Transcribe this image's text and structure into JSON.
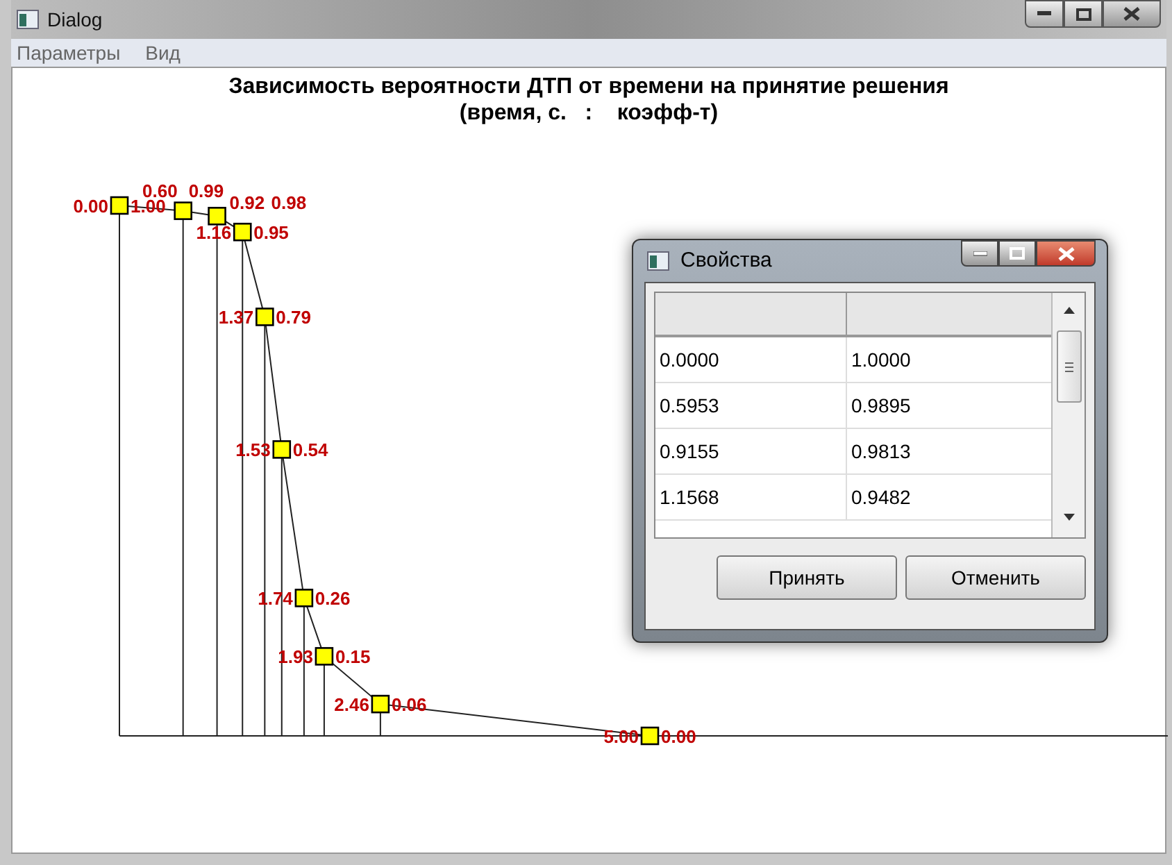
{
  "window": {
    "title": "Dialog"
  },
  "menu": [
    {
      "label": "Параметры"
    },
    {
      "label": "Вид"
    }
  ],
  "graph": {
    "title": "Зависимость вероятности ДТП от времени на принятие решения",
    "subtitle": "(время, с.   :    коэфф-т)",
    "points": [
      {
        "time": "0.00",
        "coef": "1.00"
      },
      {
        "time": "0.60",
        "coef": "0.99"
      },
      {
        "time": "0.92",
        "coef": "0.98"
      },
      {
        "time": "1.16",
        "coef": "0.95"
      },
      {
        "time": "1.37",
        "coef": "0.79"
      },
      {
        "time": "1.53",
        "coef": "0.54"
      },
      {
        "time": "1.74",
        "coef": "0.26"
      },
      {
        "time": "1.93",
        "coef": "0.15"
      },
      {
        "time": "2.46",
        "coef": "0.06"
      },
      {
        "time": "5.00",
        "coef": "0.00"
      }
    ]
  },
  "dialog": {
    "title": "Свойства",
    "rows": [
      [
        "0.0000",
        "1.0000"
      ],
      [
        "0.5953",
        "0.9895"
      ],
      [
        "0.9155",
        "0.9813"
      ],
      [
        "1.1568",
        "0.9482"
      ]
    ],
    "buttons": [
      {
        "label": "Принять"
      },
      {
        "label": "Отменить"
      }
    ]
  }
}
